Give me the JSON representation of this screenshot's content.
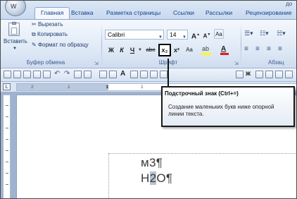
{
  "window": {
    "title_fragment": "до"
  },
  "office_button": {
    "label": "W"
  },
  "tabs": [
    {
      "label": "Главная",
      "active": true
    },
    {
      "label": "Вставка"
    },
    {
      "label": "Разметка страницы"
    },
    {
      "label": "Ссылки"
    },
    {
      "label": "Рассылки"
    },
    {
      "label": "Рецензирование"
    }
  ],
  "clipboard": {
    "paste_label": "Вставить",
    "cut_label": "Вырезать",
    "copy_label": "Копировать",
    "format_painter_label": "Формат по образцу",
    "group_label": "Буфер обмена"
  },
  "font": {
    "font_name": "Calibri",
    "font_size": "14",
    "grow_label": "A",
    "shrink_label": "A",
    "clear_label": "Aa",
    "bold": "Ж",
    "italic": "К",
    "underline": "Ч",
    "strike": "abe",
    "subscript": "x₂",
    "superscript": "x²",
    "case": "Aa",
    "font_color": "A",
    "group_label": "Шрифт"
  },
  "paragraph": {
    "group_label": "Абзац"
  },
  "ruler": {
    "corner": "L",
    "ticks": [
      "2",
      "1",
      "1"
    ]
  },
  "tooltip": {
    "title": "Подстрочный знак (Ctrl+=)",
    "body": "Создание маленьких букв ниже опорной линии текста."
  },
  "document": {
    "line1": {
      "base": "м3",
      "mark": "¶"
    },
    "line2": {
      "before": "Н",
      "highlighted": "2",
      "after": "О",
      "mark": "¶"
    }
  },
  "colors": {
    "tab_text": "#15428b",
    "ribbon_bg": "#dce7f5",
    "highlight": "#b8c3d2",
    "font_color_bar": "#e21b1b"
  }
}
